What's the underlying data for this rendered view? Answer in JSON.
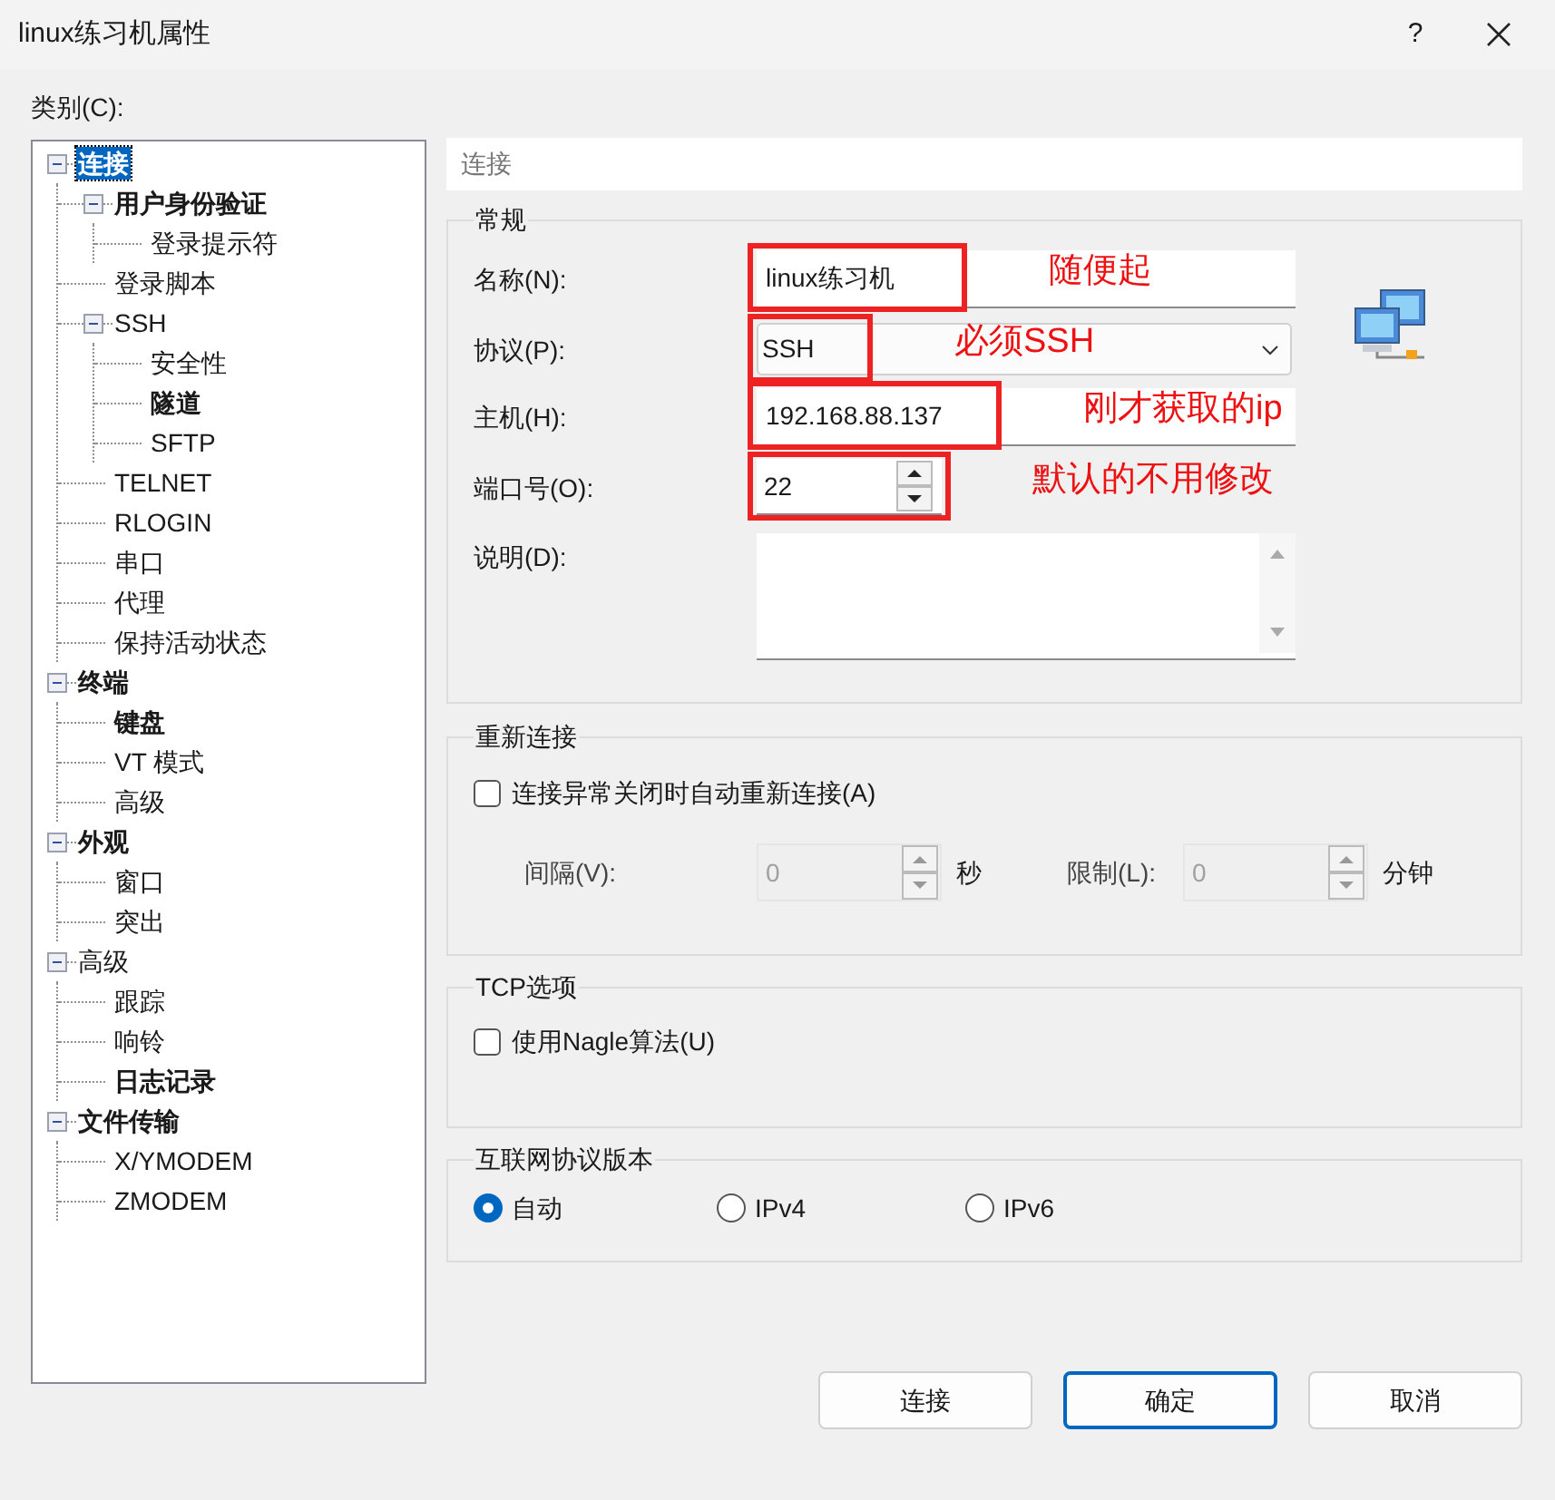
{
  "window": {
    "title": "linux练习机属性",
    "help": "?"
  },
  "category_label": "类别(C):",
  "tree": [
    {
      "label": "连接",
      "bold": true,
      "selected": true,
      "expanded": true,
      "children": [
        {
          "label": "用户身份验证",
          "bold": true,
          "selected": false,
          "expanded": true,
          "children": [
            {
              "label": "登录提示符",
              "bold": false,
              "selected": false
            }
          ]
        },
        {
          "label": "登录脚本",
          "bold": false,
          "selected": false
        },
        {
          "label": "SSH",
          "bold": false,
          "selected": false,
          "expanded": true,
          "children": [
            {
              "label": "安全性",
              "bold": false,
              "selected": false
            },
            {
              "label": "隧道",
              "bold": true,
              "selected": false
            },
            {
              "label": "SFTP",
              "bold": false,
              "selected": false
            }
          ]
        },
        {
          "label": "TELNET",
          "bold": false,
          "selected": false
        },
        {
          "label": "RLOGIN",
          "bold": false,
          "selected": false
        },
        {
          "label": "串口",
          "bold": false,
          "selected": false
        },
        {
          "label": "代理",
          "bold": false,
          "selected": false
        },
        {
          "label": "保持活动状态",
          "bold": false,
          "selected": false
        }
      ]
    },
    {
      "label": "终端",
      "bold": true,
      "selected": false,
      "expanded": true,
      "children": [
        {
          "label": "键盘",
          "bold": true,
          "selected": false
        },
        {
          "label": "VT 模式",
          "bold": false,
          "selected": false
        },
        {
          "label": "高级",
          "bold": false,
          "selected": false
        }
      ]
    },
    {
      "label": "外观",
      "bold": true,
      "selected": false,
      "expanded": true,
      "children": [
        {
          "label": "窗口",
          "bold": false,
          "selected": false
        },
        {
          "label": "突出",
          "bold": false,
          "selected": false
        }
      ]
    },
    {
      "label": "高级",
      "bold": false,
      "selected": false,
      "expanded": true,
      "children": [
        {
          "label": "跟踪",
          "bold": false,
          "selected": false
        },
        {
          "label": "响铃",
          "bold": false,
          "selected": false
        },
        {
          "label": "日志记录",
          "bold": true,
          "selected": false
        }
      ]
    },
    {
      "label": "文件传输",
      "bold": true,
      "selected": false,
      "expanded": true,
      "children": [
        {
          "label": "X/YMODEM",
          "bold": false,
          "selected": false
        },
        {
          "label": "ZMODEM",
          "bold": false,
          "selected": false
        }
      ]
    }
  ],
  "page_header": "连接",
  "general": {
    "title": "常规",
    "fields": [
      {
        "kind": "text",
        "label": "名称(N):",
        "value": "linux练习机",
        "annotation": "随便起"
      },
      {
        "kind": "dropdown",
        "label": "协议(P):",
        "value": "SSH",
        "annotation": "必须SSH"
      },
      {
        "kind": "text",
        "label": "主机(H):",
        "value": "192.168.88.137",
        "annotation": "刚才获取的ip"
      },
      {
        "kind": "spinner",
        "label": "端口号(O):",
        "value": "22",
        "annotation": "默认的不用修改"
      },
      {
        "kind": "textarea",
        "label": "说明(D):"
      }
    ]
  },
  "reconnect": {
    "title": "重新连接",
    "checkbox": {
      "label": "连接异常关闭时自动重新连接(A)",
      "checked": false
    },
    "interval": {
      "label": "间隔(V):",
      "value": "0",
      "unit": "秒",
      "disabled": true
    },
    "limit": {
      "label": "限制(L):",
      "value": "0",
      "unit": "分钟",
      "disabled": true
    }
  },
  "tcp": {
    "title": "TCP选项",
    "checkbox": {
      "label": "使用Nagle算法(U)",
      "checked": false
    }
  },
  "ip_version": {
    "title": "互联网协议版本",
    "options": [
      {
        "label": "自动",
        "selected": true
      },
      {
        "label": "IPv4",
        "selected": false
      },
      {
        "label": "IPv6",
        "selected": false
      }
    ]
  },
  "buttons": [
    {
      "label": "连接",
      "default": false
    },
    {
      "label": "确定",
      "default": true
    },
    {
      "label": "取消",
      "default": false
    }
  ]
}
